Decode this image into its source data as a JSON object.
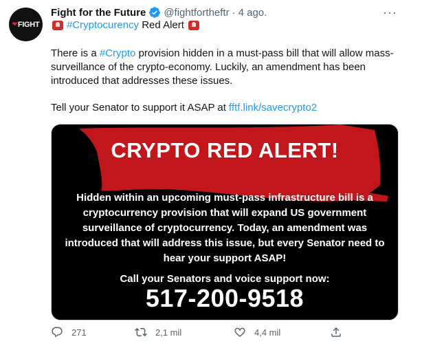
{
  "author": {
    "avatar_text": "FIGHT",
    "name": "Fight for the Future",
    "handle": "@fightfortheftr",
    "separator": "·",
    "date": "4 ago."
  },
  "more_label": "···",
  "headline": {
    "hashtag": "#Cryptocurency",
    "text": " Red Alert"
  },
  "body": {
    "p1_a": "There is a ",
    "p1_hashtag": "#Crypto",
    "p1_b": " provision hidden in a must-pass bill that will allow mass-surveillance of the crypto-economy. Luckily, an amendment has been introduced that addresses these issues.",
    "p2_text": "Tell your Senator to support it ASAP at ",
    "p2_link": "fftf.link/savecrypto2"
  },
  "card": {
    "title": "CRYPTO RED ALERT!",
    "body": "Hidden within an upcoming must-pass infrastructure bill is a cryptocurrency provision that will expand US government surveillance of cryptocurrency. Today, an amendment was introduced that will address this issue, but every Senator need to hear your support ASAP!",
    "call": "Call your Senators and voice support now:",
    "phone": "517-200-9518",
    "accent_color": "#c0161c"
  },
  "actions": {
    "reply_count": "271",
    "retweet_count": "2,1 mil",
    "like_count": "4,4 mil"
  },
  "colors": {
    "link": "#1d9bf0",
    "muted": "#536471",
    "verified": "#1d9bf0"
  }
}
